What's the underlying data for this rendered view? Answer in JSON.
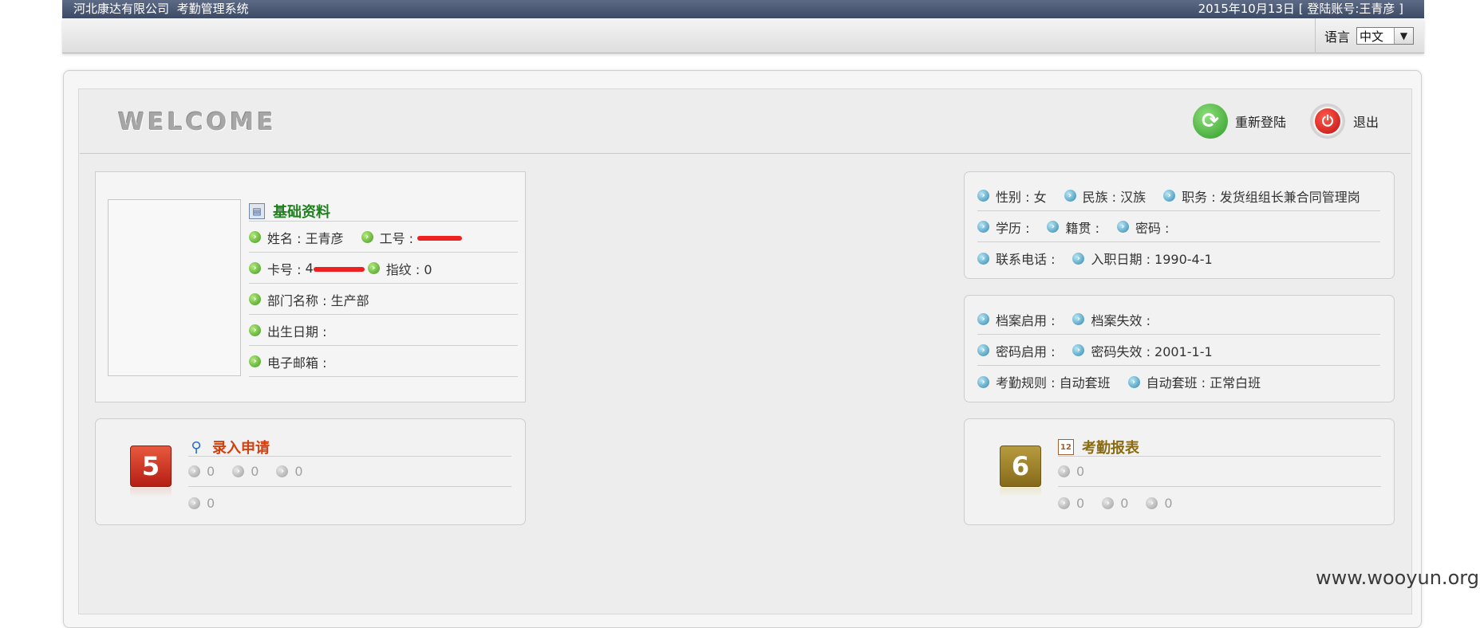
{
  "topbar": {
    "company": "河北康达有限公司",
    "system": "考勤管理系统",
    "status": "2015年10月13日 [ 登陆账号:王青彦 ]"
  },
  "toolbar": {
    "language_label": "语言",
    "language_value": "中文"
  },
  "header": {
    "welcome": "WELCOME",
    "relogin": "重新登陆",
    "logout": "退出"
  },
  "basic_info": {
    "title": "基础资料",
    "name": "姓名 : 王青彦",
    "employee_no_label": "工号 :",
    "card_no_label": "卡号 :",
    "card_no_visible_prefix": "4",
    "fingerprint": "指纹 : 0",
    "department": "部门名称 : 生产部",
    "birthday": "出生日期 :",
    "email": "电子邮箱 :"
  },
  "personal": {
    "gender": "性别 : 女",
    "ethnicity": "民族 : 汉族",
    "position": "职务 : 发货组组长兼合同管理岗",
    "education": "学历 :",
    "native_place": "籍贯 :",
    "password": "密码 :",
    "phone": "联系电话 :",
    "hire_date": "入职日期 : 1990-4-1"
  },
  "records": {
    "file_enabled": "档案启用 :",
    "file_expired": "档案失效 :",
    "pwd_enabled": "密码启用 :",
    "pwd_expired": "密码失效 : 2001-1-1",
    "rule": "考勤规则 : 自动套班",
    "auto_shift": "自动套班 : 正常白班"
  },
  "entry": {
    "title": "录入申请",
    "badge": "5",
    "values_row1": [
      "0",
      "0",
      "0"
    ],
    "values_row2": [
      "0"
    ]
  },
  "report": {
    "title": "考勤报表",
    "badge": "6",
    "values_row1": [
      "0"
    ],
    "values_row2": [
      "0",
      "0",
      "0"
    ]
  },
  "watermark": "www.wooyun.org",
  "colors": {
    "topbar": "#4a5672",
    "title_green": "#208020",
    "title_red": "#d24010",
    "title_olive": "#8a6a10",
    "redaction": "#ee2020"
  }
}
